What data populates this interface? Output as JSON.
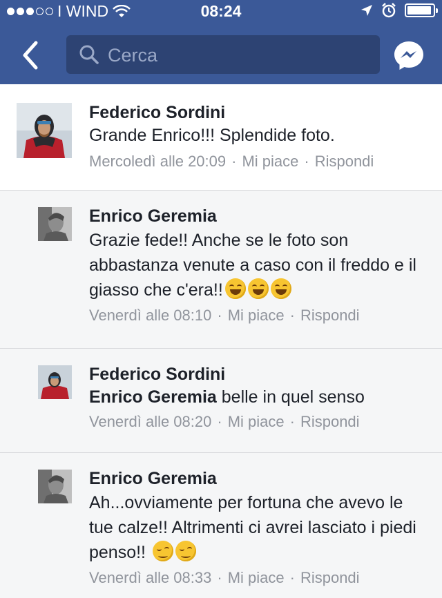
{
  "status_bar": {
    "carrier": "I WIND",
    "time": "08:24",
    "battery_level": 0.95,
    "signal_bars_filled": 3,
    "signal_bars_total": 5
  },
  "nav": {
    "back_icon": "chevron-left-icon",
    "search_placeholder": "Cerca",
    "messenger_icon": "messenger-icon"
  },
  "comments": [
    {
      "author": "Federico Sordini",
      "text": "Grande Enrico!!! Splendide foto.",
      "time": "Mercoledì alle 20:09",
      "like": "Mi piace",
      "reply": "Rispondi"
    },
    {
      "author": "Enrico Geremia",
      "text": "Grazie fede!! Anche se le foto son abbastanza venute a caso con il freddo e il giasso che c'era!!",
      "emoji": "🤣🤣🤣",
      "time": "Venerdì alle 08:10",
      "like": "Mi piace",
      "reply": "Rispondi"
    },
    {
      "author": "Federico Sordini",
      "mention": "Enrico Geremia",
      "text": "belle in quel senso",
      "time": "Venerdì alle 08:20",
      "like": "Mi piace",
      "reply": "Rispondi"
    },
    {
      "author": "Enrico Geremia",
      "text": "Ah...ovviamente per fortuna che avevo le tue calze!! Altrimenti ci avrei lasciato i piedi penso!!",
      "emoji": "😉😉",
      "time": "Venerdì alle 08:33",
      "like": "Mi piace",
      "reply": "Rispondi"
    }
  ],
  "colors": {
    "header": "#3b5998",
    "search_bg": "#2d4373",
    "meta_text": "#90949c"
  }
}
